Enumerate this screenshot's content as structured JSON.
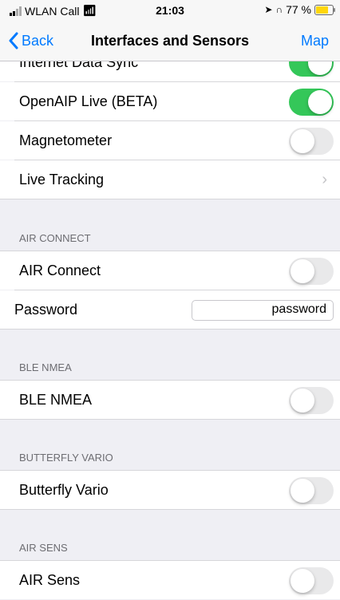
{
  "status": {
    "carrier": "WLAN Call",
    "time": "21:03",
    "battery": "77 %"
  },
  "nav": {
    "back_label": "Back",
    "title": "Interfaces and Sensors",
    "right_label": "Map"
  },
  "rows": {
    "internet_data_sync": "Internet Data Sync",
    "openaip_live": "OpenAIP Live (BETA)",
    "magnetometer": "Magnetometer",
    "live_tracking": "Live Tracking"
  },
  "air_connect": {
    "header": "AIR CONNECT",
    "toggle_label": "AIR Connect",
    "password_label": "Password",
    "password_value": "password"
  },
  "ble_nmea": {
    "header": "BLE NMEA",
    "toggle_label": "BLE NMEA"
  },
  "butterfly_vario": {
    "header": "BUTTERFLY VARIO",
    "toggle_label": "Butterfly Vario"
  },
  "air_sens": {
    "header": "AIR SENS",
    "toggle_label": "AIR Sens"
  },
  "colors": {
    "accent": "#007aff",
    "toggle_on": "#34c759",
    "toggle_off": "#e9e9ea",
    "background": "#efeff4"
  }
}
